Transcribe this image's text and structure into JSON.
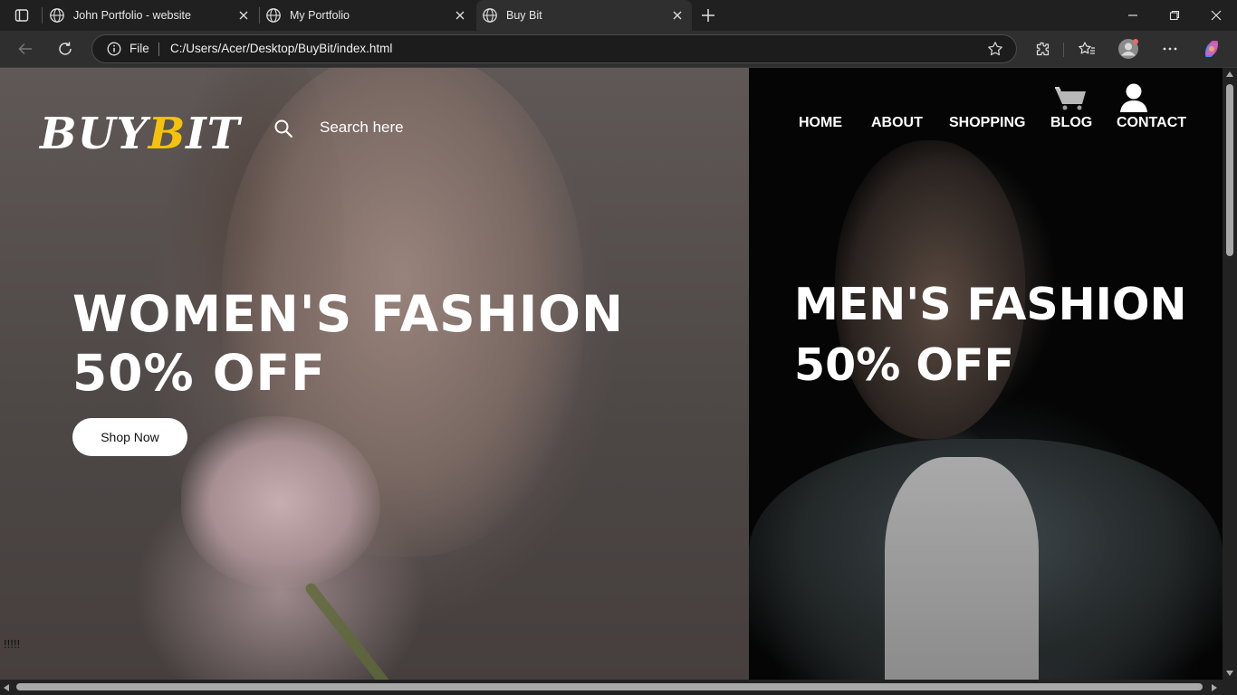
{
  "browser": {
    "tabs": [
      {
        "title": "John Portfolio - website",
        "active": false
      },
      {
        "title": "My Portfolio",
        "active": false
      },
      {
        "title": "Buy Bit",
        "active": true
      }
    ],
    "address": {
      "scheme_label": "File",
      "url": "C:/Users/Acer/Desktop/BuyBit/index.html"
    }
  },
  "site": {
    "logo": {
      "part1": "BUY",
      "part2": "B",
      "part3": "IT",
      "accent_color": "#f4c20d"
    },
    "search": {
      "placeholder": "Search here"
    },
    "nav": [
      "HOME",
      "ABOUT",
      "SHOPPING",
      "BLOG",
      "CONTACT"
    ],
    "icons": [
      "cart-icon",
      "user-icon",
      "search-icon"
    ]
  },
  "hero": {
    "women": {
      "line1": "WOMEN'S FASHION",
      "line2": "50% OFF",
      "button": "Shop Now"
    },
    "men": {
      "line1": "MEN'S FASHION",
      "line2": "50% OFF"
    },
    "stray_text": "!!!!!"
  }
}
